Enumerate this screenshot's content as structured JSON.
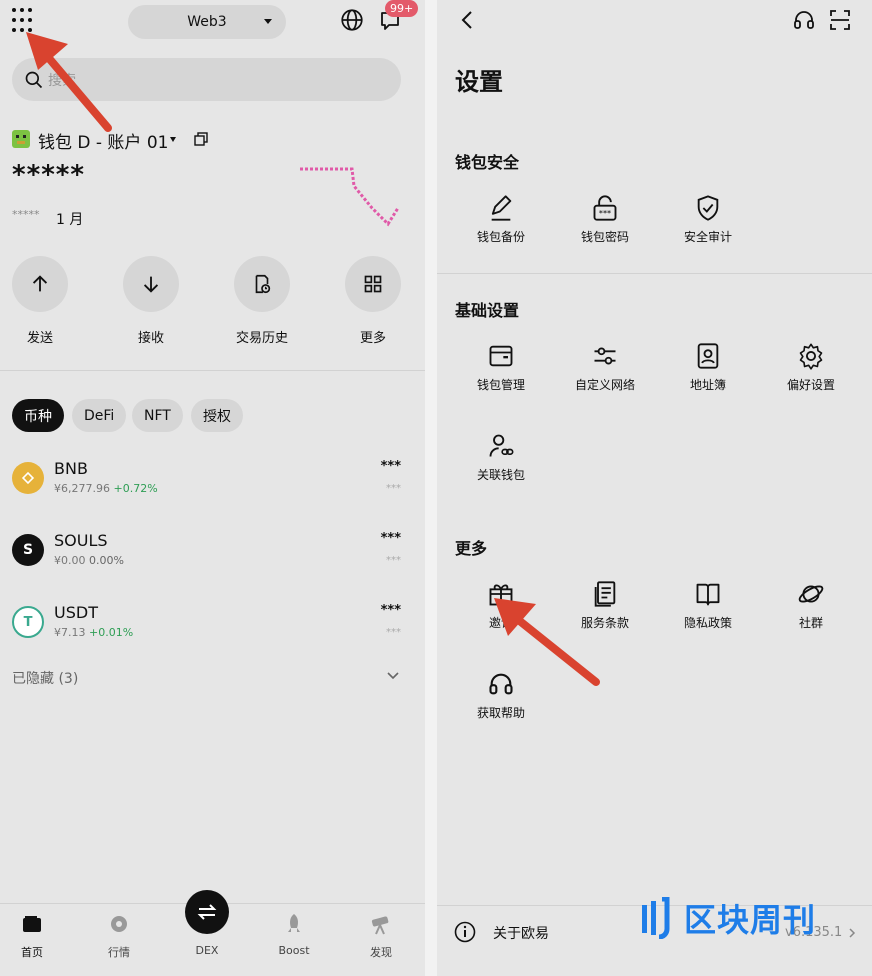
{
  "left": {
    "header": {
      "network_label": "Web3",
      "notification_badge": "99+"
    },
    "search": {
      "placeholder": "搜索"
    },
    "wallet": {
      "name": "钱包 D - 账户 01",
      "balance_masked": "*****",
      "sub_masked": "*****",
      "period": "1 月"
    },
    "actions": [
      {
        "label": "发送",
        "icon": "arrow-up-icon"
      },
      {
        "label": "接收",
        "icon": "arrow-down-icon"
      },
      {
        "label": "交易历史",
        "icon": "history-icon"
      },
      {
        "label": "更多",
        "icon": "grid-icon"
      }
    ],
    "filter_tabs": [
      {
        "label": "币种",
        "active": true
      },
      {
        "label": "DeFi",
        "active": false
      },
      {
        "label": "NFT",
        "active": false
      },
      {
        "label": "授权",
        "active": false
      }
    ],
    "assets": [
      {
        "symbol": "BNB",
        "price": "¥6,277.96",
        "change": "+0.72%",
        "amount": "***",
        "value": "***",
        "icon_color": "#e6b23a"
      },
      {
        "symbol": "SOULS",
        "price": "¥0.00",
        "change": "0.00%",
        "amount": "***",
        "value": "***",
        "icon_color": "#111111"
      },
      {
        "symbol": "USDT",
        "price": "¥7.13",
        "change": "+0.01%",
        "amount": "***",
        "value": "***",
        "icon_color": "#3aa98f"
      }
    ],
    "hidden_tokens": "已隐藏 (3)",
    "tabbar": [
      {
        "label": "首页",
        "icon": "wallet-icon",
        "active": true
      },
      {
        "label": "行情",
        "icon": "market-icon",
        "active": false
      },
      {
        "label": "DEX",
        "icon": "swap-icon",
        "active": false
      },
      {
        "label": "Boost",
        "icon": "rocket-icon",
        "active": false
      },
      {
        "label": "发现",
        "icon": "telescope-icon",
        "active": false
      }
    ]
  },
  "right": {
    "title": "设置",
    "sections": [
      {
        "title": "钱包安全",
        "items": [
          {
            "label": "钱包备份",
            "icon": "pen-icon"
          },
          {
            "label": "钱包密码",
            "icon": "lock-icon"
          },
          {
            "label": "安全审计",
            "icon": "shield-icon"
          }
        ]
      },
      {
        "title": "基础设置",
        "items": [
          {
            "label": "钱包管理",
            "icon": "wallet-icon"
          },
          {
            "label": "自定义网络",
            "icon": "sliders-icon"
          },
          {
            "label": "地址簿",
            "icon": "contacts-icon"
          },
          {
            "label": "偏好设置",
            "icon": "gear-icon"
          },
          {
            "label": "关联钱包",
            "icon": "user-link-icon"
          }
        ]
      },
      {
        "title": "更多",
        "items": [
          {
            "label": "邀请",
            "icon": "gift-icon"
          },
          {
            "label": "服务条款",
            "icon": "document-icon"
          },
          {
            "label": "隐私政策",
            "icon": "book-icon"
          },
          {
            "label": "社群",
            "icon": "planet-icon"
          },
          {
            "label": "获取帮助",
            "icon": "headset-icon"
          }
        ]
      }
    ],
    "footer": {
      "label": "关于欧易",
      "version": "v6.135.1"
    }
  },
  "watermark": "区块周刊",
  "colors": {
    "accent": "#111111",
    "badge": "#e35a6a",
    "positive": "#2f9e55",
    "chart": "#e05aa8",
    "arrow": "#d9432f",
    "watermark": "#1e7de8"
  }
}
